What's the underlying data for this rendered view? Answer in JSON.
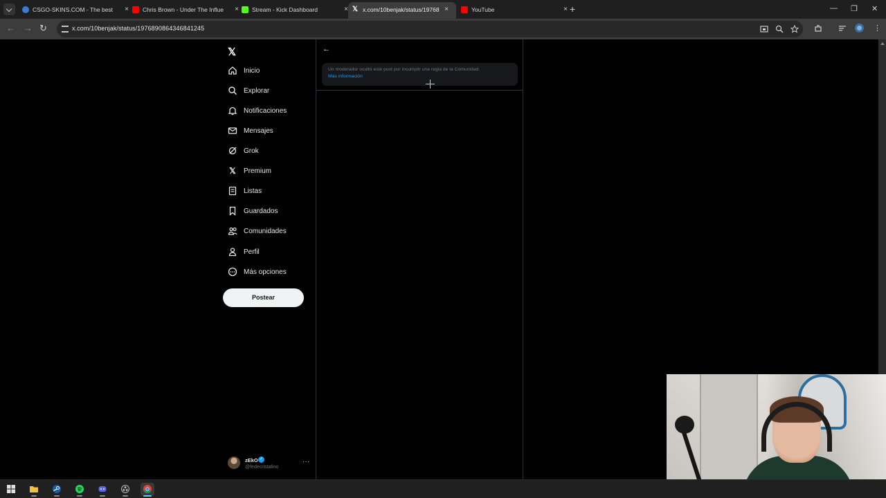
{
  "browser": {
    "tabs": [
      {
        "label": "CSGO-SKINS.COM - The best C",
        "favicon": "csgoskins-globe-icon",
        "color": "#3a7bd5",
        "active": false
      },
      {
        "label": "Chris Brown - Under The Influe",
        "favicon": "youtube-icon",
        "color": "#ff0000",
        "active": false
      },
      {
        "label": "Stream - Kick Dashboard",
        "favicon": "kick-icon",
        "color": "#53fc18",
        "active": false
      },
      {
        "label": "x.com/10benjak/status/19768",
        "favicon": "x-icon",
        "color": "#ffffff",
        "active": true
      },
      {
        "label": "YouTube",
        "favicon": "youtube-icon",
        "color": "#ff0000",
        "active": false
      }
    ],
    "tab_close": "×",
    "new_tab": "+",
    "url": "x.com/10benjak/status/1976890864346841245"
  },
  "x": {
    "nav": [
      {
        "label": "Inicio",
        "icon": "home-icon"
      },
      {
        "label": "Explorar",
        "icon": "search-icon"
      },
      {
        "label": "Notificaciones",
        "icon": "bell-icon"
      },
      {
        "label": "Mensajes",
        "icon": "envelope-icon"
      },
      {
        "label": "Grok",
        "icon": "grok-icon"
      },
      {
        "label": "Premium",
        "icon": "x-premium-icon"
      },
      {
        "label": "Listas",
        "icon": "list-icon"
      },
      {
        "label": "Guardados",
        "icon": "bookmark-icon"
      },
      {
        "label": "Comunidades",
        "icon": "communities-icon"
      },
      {
        "label": "Perfil",
        "icon": "person-icon"
      },
      {
        "label": "Más opciones",
        "icon": "more-circle-icon"
      }
    ],
    "post_button": "Postear",
    "account": {
      "name": "zEkO",
      "handle": "@fedecristalino",
      "verified": true,
      "more": "···"
    },
    "notice": {
      "text": "Un moderador ocultó este post por incumplir una regla de la Comunidad.",
      "link": "Más información"
    },
    "accent": "#1d9bf0"
  },
  "taskbar": {
    "apps": [
      "windows-start-icon",
      "file-explorer-icon",
      "steam-icon",
      "spotify-icon",
      "discord-icon",
      "obs-icon",
      "chrome-icon"
    ]
  }
}
